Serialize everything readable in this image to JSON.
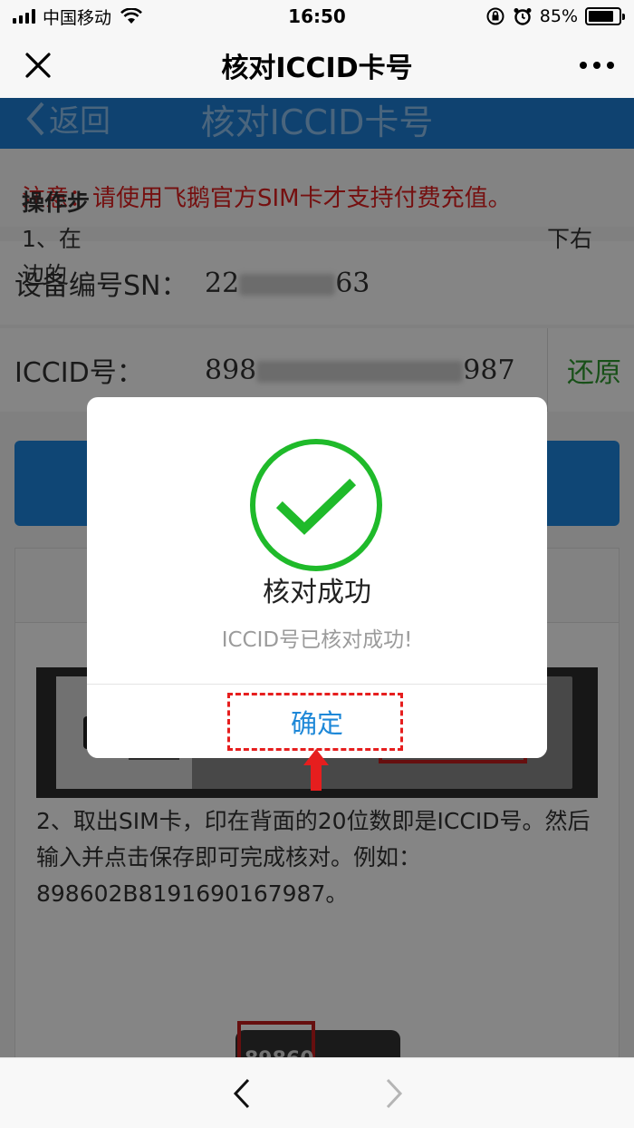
{
  "status_bar": {
    "carrier": "中国移动",
    "time": "16:50",
    "battery": "85%",
    "battery_level": 0.85
  },
  "nav": {
    "title": "核对ICCID卡号",
    "close_icon": "close-icon",
    "more_icon": "more-icon"
  },
  "page": {
    "back_label": "返回",
    "header_title": "核对ICCID卡号",
    "header_color": "#1d7fd6",
    "notice": "注意：请使用飞鹅官方SIM卡才支持付费充值。",
    "sn_label": "设备编号SN：",
    "sn_prefix": "22",
    "sn_suffix": "63",
    "iccid_label": "ICCID号：",
    "iccid_prefix": "898",
    "iccid_suffix": "987",
    "restore_label": "还原",
    "help_title": "操作步",
    "help_step1_start": "1、在",
    "help_step1_end": "下右",
    "help_step1_line2": "边的",
    "help_step2": "2、取出SIM卡，印在背面的20位数即是ICCID号。然后输入并点击保存即可完成核对。例如：898602B8191690167987。",
    "sim_number": "89860"
  },
  "dialog": {
    "title": "核对成功",
    "message": "ICCID号已核对成功!",
    "confirm_label": "确定",
    "success_color": "#1fba2a",
    "highlight_color": "#e61e1e"
  },
  "toolbar": {
    "back_icon": "chevron-left-icon",
    "forward_icon": "chevron-right-icon"
  }
}
